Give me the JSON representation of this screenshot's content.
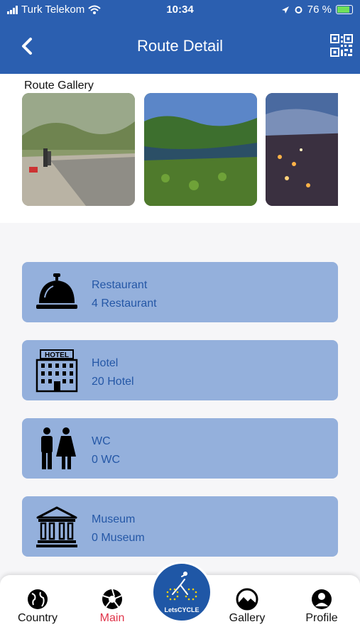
{
  "status_bar": {
    "carrier": "Turk Telekom",
    "time": "10:34",
    "battery": "76 %",
    "battery_level": 0.76
  },
  "header": {
    "title": "Route Detail",
    "back_icon": "chevron-left-icon",
    "qr_icon": "qr-code-icon"
  },
  "gallery": {
    "label": "Route Gallery",
    "images": [
      "river-bank-with-hikers",
      "lake-with-water-lilies",
      "coastal-town-at-night"
    ]
  },
  "amenities": [
    {
      "icon": "service-bell-icon",
      "name": "Restaurant",
      "count": "4 Restaurant"
    },
    {
      "icon": "hotel-building-icon",
      "name": "Hotel",
      "count": "20 Hotel"
    },
    {
      "icon": "restroom-icon",
      "name": "WC",
      "count": "0 WC"
    },
    {
      "icon": "museum-icon",
      "name": "Museum",
      "count": "0 Museum"
    }
  ],
  "tabbar": {
    "items": [
      {
        "label": "Country",
        "icon": "globe-icon"
      },
      {
        "label": "Main",
        "icon": "aperture-icon",
        "active": true
      },
      {
        "label": "Gallery",
        "icon": "landscape-icon"
      },
      {
        "label": "Profile",
        "icon": "person-icon"
      }
    ],
    "center_logo": "LetsCYCLE"
  },
  "colors": {
    "primary": "#2b5fb0",
    "card": "#94b0dc",
    "card_text": "#2457a6",
    "active_tab": "#e0344a"
  }
}
